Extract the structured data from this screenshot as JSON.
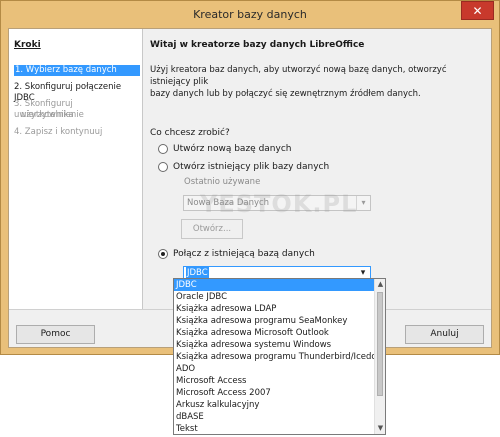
{
  "window": {
    "title": "Kreator bazy danych",
    "close_glyph": "✕"
  },
  "steps": {
    "title": "Kroki",
    "items": [
      {
        "label": "1. Wybierz bazę danych",
        "state": "active"
      },
      {
        "label": "2. Skonfiguruj połączenie JDBC",
        "state": "normal"
      },
      {
        "label": "3. Skonfiguruj uwierzytelnienie",
        "state": "disabled"
      },
      {
        "label": "użytkownika",
        "state": "disabled"
      },
      {
        "label": "4. Zapisz i kontynuuj",
        "state": "disabled"
      }
    ]
  },
  "main": {
    "welcome": "Witaj w kreatorze bazy danych LibreOffice",
    "intro_line1": "Użyj kreatora baz danych, aby utworzyć nową bazę danych, otworzyć istniejący plik",
    "intro_line2": "bazy danych lub by połączyć się zewnętrznym źródłem danych.",
    "question": "Co chcesz zrobić?",
    "options": {
      "create_new": "Utwórz nową bazę danych",
      "open_existing": "Otwórz istniejący plik bazy danych",
      "connect": "Połącz z istniejącą bazą danych"
    },
    "selected_option": "connect",
    "recent_label": "Ostatnio używane",
    "recent_value": "Nowa Baza Danych",
    "open_button": "Otwórz...",
    "connect_value": "JDBC"
  },
  "footer": {
    "help": "Pomoc",
    "cancel": "Anuluj"
  },
  "dropdown": {
    "items": [
      "JDBC",
      "Oracle JDBC",
      "Książka adresowa LDAP",
      "Książka adresowa programu SeaMonkey",
      "Książka adresowa Microsoft Outlook",
      "Książka adresowa systemu Windows",
      "Książka adresowa programu Thunderbird/Icedove",
      "ADO",
      "Microsoft Access",
      "Microsoft Access 2007",
      "Arkusz kalkulacyjny",
      "dBASE",
      "Tekst"
    ],
    "selected": "JDBC",
    "scroll_up": "▲",
    "scroll_down": "▼"
  },
  "watermark": "YESTOK.PL",
  "colors": {
    "frame": "#e9c07a",
    "close": "#c8392c",
    "selection": "#3399ff"
  }
}
